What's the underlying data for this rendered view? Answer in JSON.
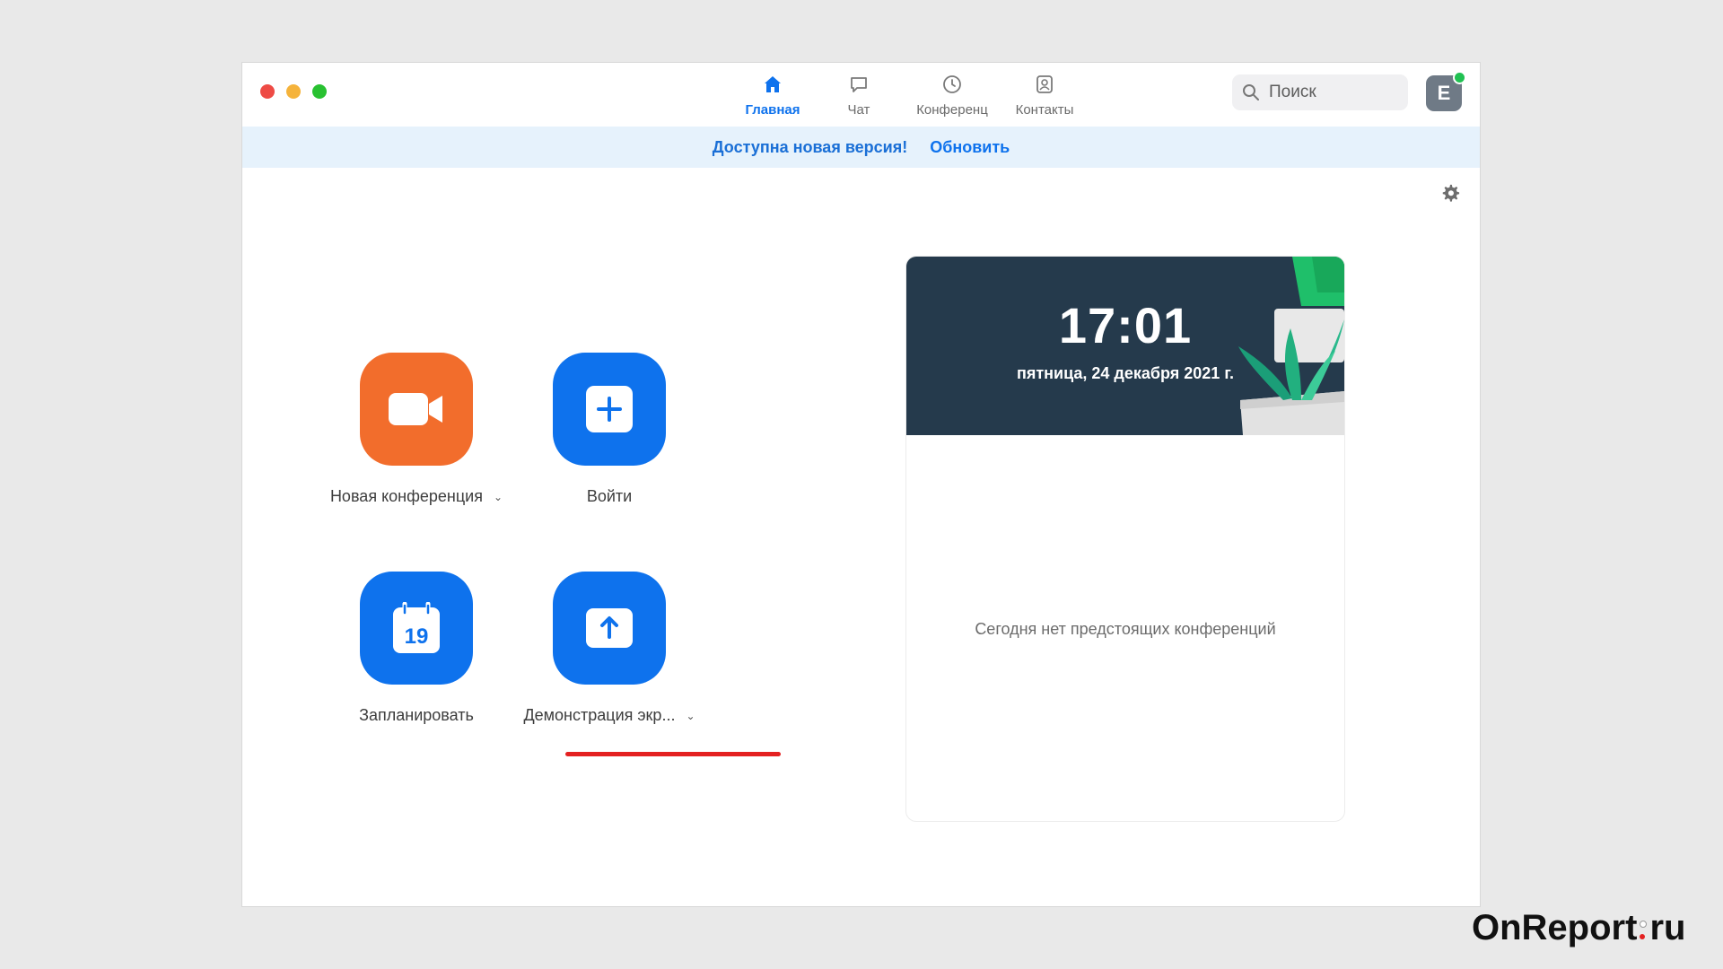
{
  "tabs": [
    {
      "label": "Главная",
      "icon": "home-icon",
      "active": true
    },
    {
      "label": "Чат",
      "icon": "chat-icon",
      "active": false
    },
    {
      "label": "Конференц",
      "icon": "clock-icon",
      "active": false
    },
    {
      "label": "Контакты",
      "icon": "contacts-icon",
      "active": false
    }
  ],
  "search": {
    "placeholder": "Поиск"
  },
  "avatar": {
    "initial": "E",
    "status_color": "#20c152"
  },
  "banner": {
    "message": "Доступна новая версия!",
    "action": "Обновить"
  },
  "actions": {
    "new_meeting": {
      "label": "Новая конференция",
      "color": "#f26d2c",
      "icon": "video-camera-icon"
    },
    "join": {
      "label": "Войти",
      "color": "#0e72ed",
      "icon": "plus-icon"
    },
    "schedule": {
      "label": "Запланировать",
      "calendar_day": "19",
      "color": "#0e72ed",
      "icon": "calendar-icon"
    },
    "share_screen": {
      "label": "Демонстрация экр...",
      "color": "#0e72ed",
      "icon": "share-up-arrow-icon"
    }
  },
  "card": {
    "time": "17:01",
    "date": "пятница, 24 декабря 2021 г.",
    "empty_message": "Сегодня нет предстоящих конференций"
  },
  "watermark": {
    "brand": "OnReport",
    "suffix": "ru"
  },
  "colors": {
    "accent": "#0e72ed",
    "header_bg": "#253a4c",
    "highlight": "#e42121"
  }
}
